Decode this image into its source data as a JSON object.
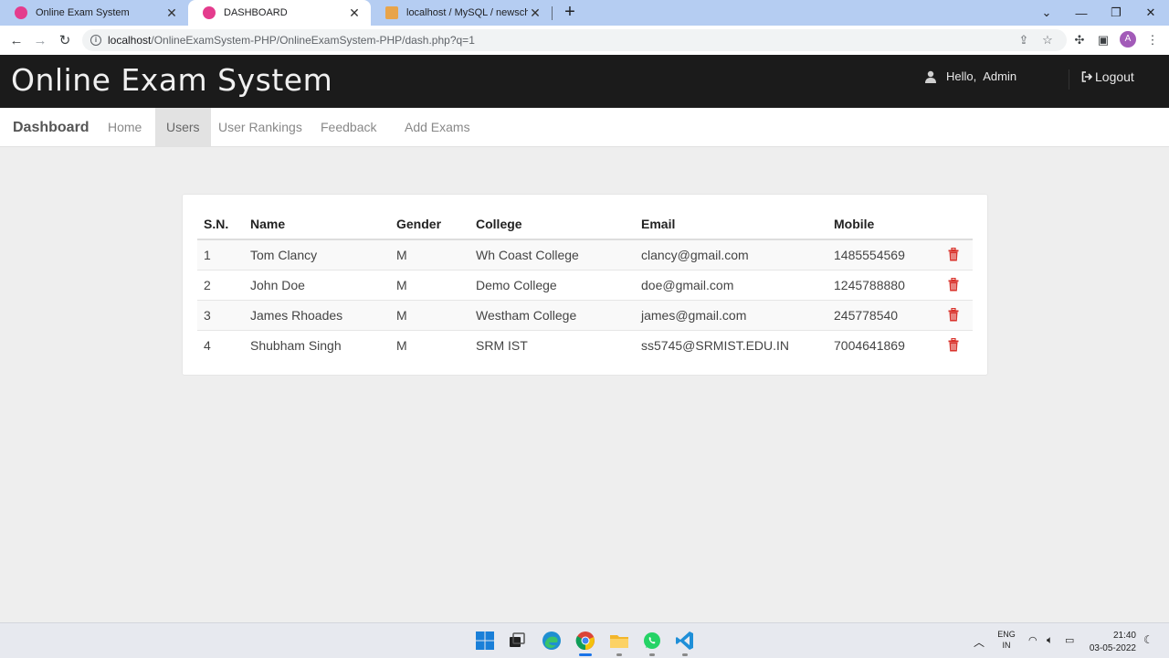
{
  "browser": {
    "tabs": [
      {
        "label": "Online Exam System",
        "icon": "exam-favicon"
      },
      {
        "label": "DASHBOARD",
        "icon": "exam-favicon"
      },
      {
        "label": "localhost / MySQL / newschema",
        "icon": "phpmyadmin-favicon"
      }
    ],
    "url_host": "localhost",
    "url_path": "/OnlineExamSystem-PHP/OnlineExamSystem-PHP/dash.php?q=1",
    "profile_initial": "A"
  },
  "header": {
    "brand": "Online Exam System",
    "hello_prefix": "Hello,",
    "user_name": "Admin",
    "logout_label": "Logout"
  },
  "nav": {
    "brand": "Dashboard",
    "items": [
      "Home",
      "Users",
      "User Rankings",
      "Feedback",
      "Add Exams"
    ],
    "active": "Users"
  },
  "users_table": {
    "headers": [
      "S.N.",
      "Name",
      "Gender",
      "College",
      "Email",
      "Mobile"
    ],
    "rows": [
      {
        "sn": "1",
        "name": "Tom Clancy",
        "gender": "M",
        "college": "Wh Coast College",
        "email": "clancy@gmail.com",
        "mobile": "1485554569"
      },
      {
        "sn": "2",
        "name": "John Doe",
        "gender": "M",
        "college": "Demo College",
        "email": "doe@gmail.com",
        "mobile": "1245788880"
      },
      {
        "sn": "3",
        "name": "James Rhoades",
        "gender": "M",
        "college": "Westham College",
        "email": "james@gmail.com",
        "mobile": "245778540"
      },
      {
        "sn": "4",
        "name": "Shubham Singh",
        "gender": "M",
        "college": "SRM IST",
        "email": "ss5745@SRMIST.EDU.IN",
        "mobile": "7004641869"
      }
    ]
  },
  "taskbar": {
    "lang_top": "ENG",
    "lang_bottom": "IN",
    "time": "21:40",
    "date": "03-05-2022"
  },
  "colors": {
    "header_bg": "#1b1b1b",
    "delete_icon": "#d9322b",
    "tab_strip": "#b5cdf2"
  }
}
